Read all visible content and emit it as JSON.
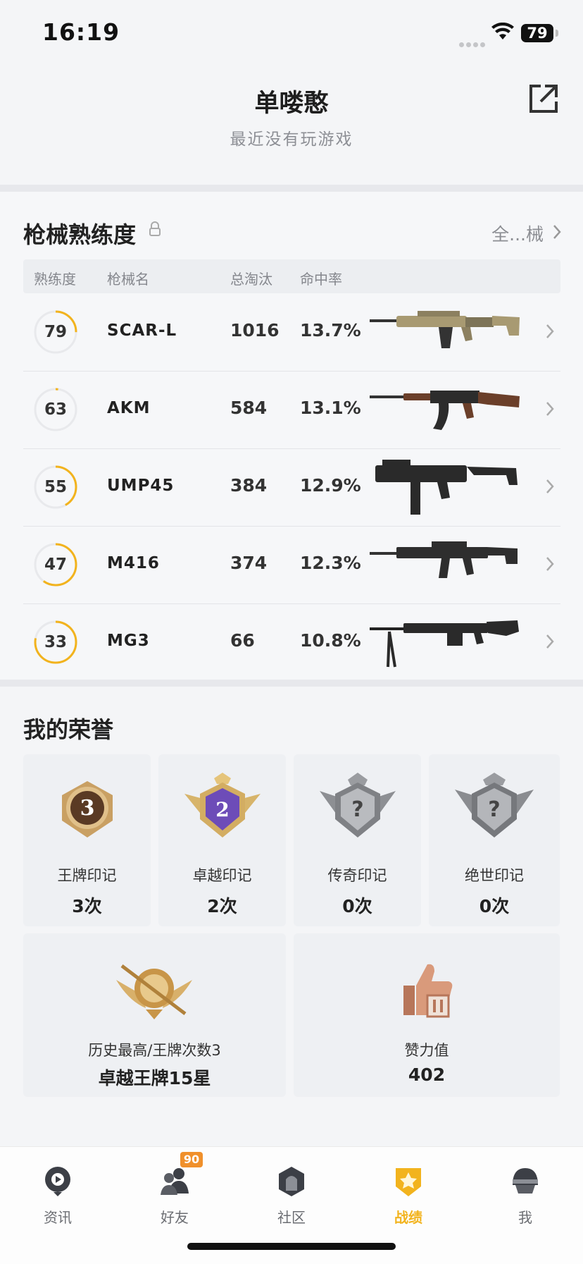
{
  "status_bar": {
    "time": "16:19",
    "battery": "79"
  },
  "header": {
    "name": "单喽憨",
    "status": "最近没有玩游戏"
  },
  "weapons": {
    "title": "枪械熟练度",
    "see_all": "全...械",
    "columns": [
      "熟练度",
      "枪械名",
      "总淘汰",
      "命中率"
    ],
    "rows": [
      {
        "level": "79",
        "name": "SCAR-L",
        "kills": "1016",
        "accuracy": "13.7%",
        "progress": 0.25,
        "gun_icon": "scar-l-rifle"
      },
      {
        "level": "63",
        "name": "AKM",
        "kills": "584",
        "accuracy": "13.1%",
        "progress": 0.02,
        "gun_icon": "akm-rifle"
      },
      {
        "level": "55",
        "name": "UMP45",
        "kills": "384",
        "accuracy": "12.9%",
        "progress": 0.42,
        "gun_icon": "ump45-smg"
      },
      {
        "level": "47",
        "name": "M416",
        "kills": "374",
        "accuracy": "12.3%",
        "progress": 0.6,
        "gun_icon": "m416-rifle"
      },
      {
        "level": "33",
        "name": "MG3",
        "kills": "66",
        "accuracy": "10.8%",
        "progress": 0.78,
        "gun_icon": "mg3-lmg"
      }
    ]
  },
  "honors": {
    "title": "我的荣誉",
    "marks": [
      {
        "label": "王牌印记",
        "value": "3次",
        "badge_text": "3"
      },
      {
        "label": "卓越印记",
        "value": "2次",
        "badge_text": "2"
      },
      {
        "label": "传奇印记",
        "value": "0次",
        "badge_text": "?"
      },
      {
        "label": "绝世印记",
        "value": "0次",
        "badge_text": "?"
      }
    ],
    "highest": {
      "label": "历史最高/王牌次数3",
      "value": "卓越王牌15星"
    },
    "likes": {
      "label": "赞力值",
      "value": "402"
    }
  },
  "tabbar": {
    "tabs": [
      {
        "label": "资讯",
        "icon": "news-icon"
      },
      {
        "label": "好友",
        "icon": "friends-icon",
        "badge": "90"
      },
      {
        "label": "社区",
        "icon": "community-icon"
      },
      {
        "label": "战绩",
        "icon": "record-icon",
        "active": true
      },
      {
        "label": "我",
        "icon": "me-icon"
      }
    ]
  },
  "colors": {
    "accent": "#f2b31d",
    "ring_track": "#e8e9ec"
  }
}
